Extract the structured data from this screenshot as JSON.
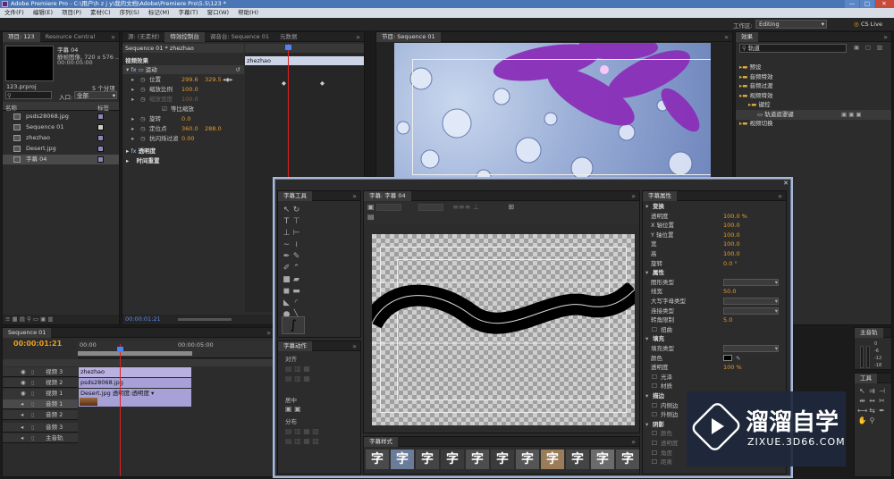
{
  "window": {
    "title": "Adobe Premiere Pro - C:\\用户\\h z j y\\我的文档\\Adobe\\Premiere Pro\\5.5\\123 *",
    "min": "—",
    "max": "□",
    "close": "✕"
  },
  "menu": [
    "文件(F)",
    "编辑(E)",
    "项目(P)",
    "素材(C)",
    "序列(S)",
    "标记(M)",
    "字幕(T)",
    "窗口(W)",
    "帮助(H)"
  ],
  "workspace": {
    "label": "工作区:",
    "value": "Editing",
    "cslive": "CS Live"
  },
  "project": {
    "tabs": [
      "项目: 123",
      "Resource Central"
    ],
    "preview_name": "字幕 04",
    "preview_info": "静帧图像, 720 x 576 ...",
    "preview_dur": "00:00:05:00",
    "proj_file": "123.prproj",
    "count": "5 个分项",
    "in_label": "入口:",
    "in_value": "全部",
    "col_name": "名称",
    "col_label": "标签",
    "items": [
      {
        "name": "psds28068.jpg",
        "type": "image",
        "color": "#8b86b8"
      },
      {
        "name": "Sequence 01",
        "type": "sequence",
        "color": "#c8d4c0"
      },
      {
        "name": "zhezhao",
        "type": "title",
        "color": "#8b86b8"
      },
      {
        "name": "Desert.jpg",
        "type": "image",
        "color": "#8b86b8"
      },
      {
        "name": "字幕 04",
        "type": "title",
        "color": "#8b86b8"
      }
    ]
  },
  "effect_controls": {
    "tabs": [
      "源: (无素材)",
      "特效控制台",
      "调音台: Sequence 01",
      "元数据"
    ],
    "header": "Sequence 01 * zhezhao",
    "timecode": "00:00",
    "section": "视频效果",
    "motion": "运动",
    "props": [
      {
        "name": "位置",
        "v1": "299.6",
        "v2": "329.5"
      },
      {
        "name": "缩放比例",
        "v1": "100.0",
        "v2": ""
      },
      {
        "name": "缩放宽度",
        "v1": "100.0",
        "v2": ""
      },
      {
        "name": "等比缩放",
        "v1": "",
        "v2": ""
      },
      {
        "name": "旋转",
        "v1": "0.0",
        "v2": ""
      },
      {
        "name": "定位点",
        "v1": "360.0",
        "v2": "288.0"
      },
      {
        "name": "抗闪烁过滤",
        "v1": "0.00",
        "v2": ""
      }
    ],
    "opacity": "透明度",
    "time_remap": "时间重置",
    "clip_label": "zhezhao",
    "current": "00:00:01:21"
  },
  "program": {
    "tab": "节目: Sequence 01"
  },
  "effects": {
    "tab": "效果",
    "search": "轨道",
    "tree": [
      {
        "label": "预设",
        "level": 0
      },
      {
        "label": "音频特效",
        "level": 0
      },
      {
        "label": "音频过渡",
        "level": 0
      },
      {
        "label": "视频特效",
        "level": 0
      },
      {
        "label": "键控",
        "level": 1
      },
      {
        "label": "轨道遮罩键",
        "level": 2
      },
      {
        "label": "视频切换",
        "level": 0
      }
    ]
  },
  "sequence": {
    "tab": "Sequence 01",
    "timecode": "00:00:01:21",
    "ruler": [
      "00:00",
      "00:00:05:00"
    ],
    "tracks": [
      {
        "name": "视频 3",
        "clip": "zhezhao"
      },
      {
        "name": "视频 2",
        "clip": "psds28068.jpg"
      },
      {
        "name": "视频 1",
        "clip": "Desert.jpg 透明度:透明度 ▾"
      },
      {
        "name": "音频 1",
        "clip": ""
      },
      {
        "name": "音频 2",
        "clip": ""
      },
      {
        "name": "音频 3",
        "clip": ""
      },
      {
        "name": "主音轨",
        "clip": ""
      }
    ]
  },
  "titler": {
    "tools_title": "字幕工具",
    "main_title": "字幕: 字幕 04",
    "props_title": "字幕属性",
    "actions_title": "字幕动作",
    "styles_title": "字幕样式",
    "actions": [
      "对齐",
      "居中",
      "分布"
    ],
    "props": [
      {
        "k": "变换",
        "v": "",
        "t": "h"
      },
      {
        "k": "透明度",
        "v": "100.0 %",
        "t": "o"
      },
      {
        "k": "X 轴位置",
        "v": "100.0",
        "t": "o"
      },
      {
        "k": "Y 轴位置",
        "v": "100.0",
        "t": "o"
      },
      {
        "k": "宽",
        "v": "100.0",
        "t": "o"
      },
      {
        "k": "高",
        "v": "100.0",
        "t": "o"
      },
      {
        "k": "旋转",
        "v": "0.0 °",
        "t": "o"
      },
      {
        "k": "属性",
        "v": "",
        "t": "h"
      },
      {
        "k": "图形类型",
        "v": "",
        "t": "d"
      },
      {
        "k": "线宽",
        "v": "50.0",
        "t": "o"
      },
      {
        "k": "大写字母类型",
        "v": "",
        "t": "d"
      },
      {
        "k": "连接类型",
        "v": "",
        "t": "d"
      },
      {
        "k": "转角限制",
        "v": "5.0",
        "t": "o"
      },
      {
        "k": "扭曲",
        "v": "",
        "t": "c"
      },
      {
        "k": "填充",
        "v": "",
        "t": "h"
      },
      {
        "k": "填充类型",
        "v": "",
        "t": "d"
      },
      {
        "k": "颜色",
        "v": "",
        "t": "s"
      },
      {
        "k": "透明度",
        "v": "100 %",
        "t": "o"
      },
      {
        "k": "光泽",
        "v": "",
        "t": "c"
      },
      {
        "k": "材质",
        "v": "",
        "t": "c"
      },
      {
        "k": "描边",
        "v": "",
        "t": "h"
      },
      {
        "k": "内侧边",
        "v": "",
        "t": "c"
      },
      {
        "k": "外侧边",
        "v": "",
        "t": "c"
      },
      {
        "k": "阴影",
        "v": "",
        "t": "h"
      },
      {
        "k": "颜色",
        "v": "",
        "t": "c"
      },
      {
        "k": "透明度",
        "v": "",
        "t": "c"
      },
      {
        "k": "角度",
        "v": "",
        "t": "c"
      },
      {
        "k": "距离",
        "v": "",
        "t": "c"
      }
    ],
    "style_glyphs": [
      "字",
      "字",
      "字",
      "字",
      "字",
      "字",
      "字",
      "字",
      "字",
      "字",
      "字"
    ]
  },
  "audio_meters": {
    "tab": "主音轨",
    "scale": [
      "0",
      "-6",
      "-12",
      "-18"
    ]
  },
  "tools": {
    "tab": "工具"
  },
  "watermark": {
    "brand": "溜溜自学",
    "url": "ZIXUE.3D66.COM"
  }
}
